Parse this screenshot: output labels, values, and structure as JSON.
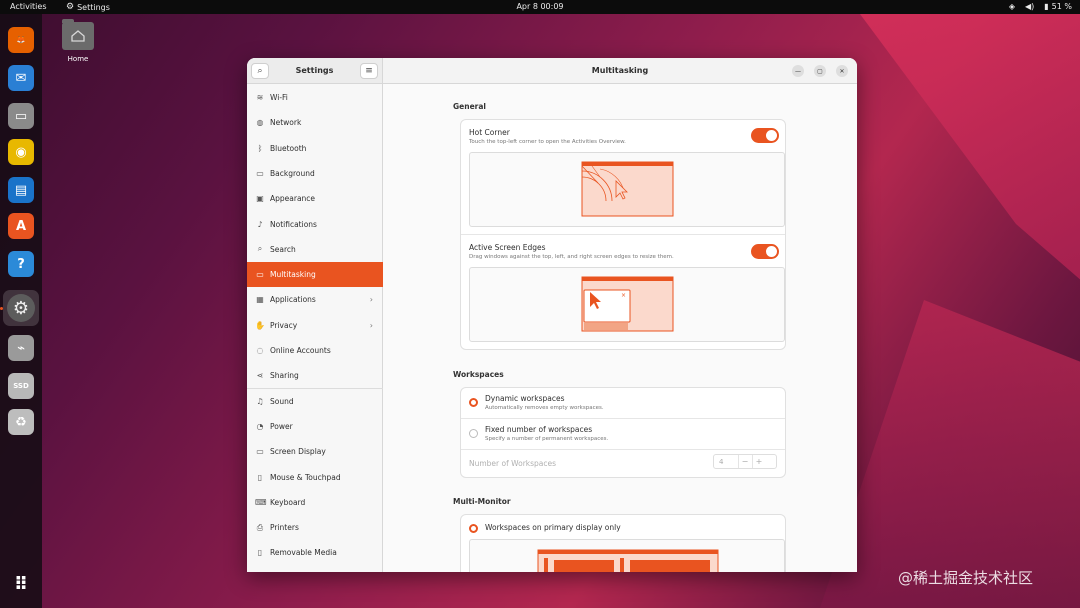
{
  "topbar": {
    "activities": "Activities",
    "app_name": "Settings",
    "clock": "Apr 8  00:09",
    "battery": "51 %"
  },
  "desktop": {
    "home_label": "Home"
  },
  "dock": {
    "items": [
      {
        "name": "firefox-icon",
        "glyph": "🦊",
        "color": "#e66000"
      },
      {
        "name": "thunderbird-icon",
        "glyph": "✉",
        "color": "#2a7fd4"
      },
      {
        "name": "files-icon",
        "glyph": "▭",
        "color": "#8a8a8a"
      },
      {
        "name": "rhythmbox-icon",
        "glyph": "◉",
        "color": "#e8b800"
      },
      {
        "name": "writer-icon",
        "glyph": "▤",
        "color": "#1a73c9"
      },
      {
        "name": "software-icon",
        "glyph": "A",
        "color": "#e95420"
      },
      {
        "name": "help-icon",
        "glyph": "?",
        "color": "#2b8ad8"
      },
      {
        "name": "settings-icon",
        "glyph": "⚙",
        "color": "#7a7a7a"
      },
      {
        "name": "usb-drive-icon",
        "glyph": "⌁",
        "color": "#9a9a9a"
      },
      {
        "name": "ssd-drive-icon",
        "glyph": "SSD",
        "color": "#b8b8b8"
      },
      {
        "name": "trash-icon",
        "glyph": "♻",
        "color": "#bdbdbd"
      },
      {
        "name": "app-grid-icon",
        "glyph": "⠿",
        "color": "transparent"
      }
    ]
  },
  "settings": {
    "sidebar_title": "Settings",
    "window_title": "Multitasking",
    "sidebar_items": [
      {
        "label": "Wi-Fi",
        "icon": "wifi-icon",
        "glyph": "≋"
      },
      {
        "label": "Network",
        "icon": "network-icon",
        "glyph": "◍"
      },
      {
        "label": "Bluetooth",
        "icon": "bluetooth-icon",
        "glyph": "ᛒ"
      },
      {
        "label": "Background",
        "icon": "background-icon",
        "glyph": "▭"
      },
      {
        "label": "Appearance",
        "icon": "appearance-icon",
        "glyph": "▣"
      },
      {
        "label": "Notifications",
        "icon": "bell-icon",
        "glyph": "♪"
      },
      {
        "label": "Search",
        "icon": "search-icon",
        "glyph": "⌕"
      },
      {
        "label": "Multitasking",
        "icon": "multitasking-icon",
        "glyph": "▭"
      },
      {
        "label": "Applications",
        "icon": "applications-icon",
        "glyph": "▦"
      },
      {
        "label": "Privacy",
        "icon": "privacy-icon",
        "glyph": "✋"
      },
      {
        "label": "Online Accounts",
        "icon": "online-accounts-icon",
        "glyph": "◌"
      },
      {
        "label": "Sharing",
        "icon": "share-icon",
        "glyph": "⋖"
      },
      {
        "label": "Sound",
        "icon": "music-note-icon",
        "glyph": "♫"
      },
      {
        "label": "Power",
        "icon": "power-icon",
        "glyph": "◔"
      },
      {
        "label": "Screen Display",
        "icon": "display-icon",
        "glyph": "▭"
      },
      {
        "label": "Mouse & Touchpad",
        "icon": "mouse-icon",
        "glyph": "▯"
      },
      {
        "label": "Keyboard",
        "icon": "keyboard-icon",
        "glyph": "⌨"
      },
      {
        "label": "Printers",
        "icon": "printer-icon",
        "glyph": "⎙"
      },
      {
        "label": "Removable Media",
        "icon": "removable-media-icon",
        "glyph": "▯"
      }
    ],
    "active_item": "Multitasking",
    "general": {
      "heading": "General",
      "hot_corner": {
        "title": "Hot Corner",
        "subtitle": "Touch the top-left corner to open the Activities Overview.",
        "enabled": true
      },
      "screen_edges": {
        "title": "Active Screen Edges",
        "subtitle": "Drag windows against the top, left, and right screen edges to resize them.",
        "enabled": true
      }
    },
    "workspaces": {
      "heading": "Workspaces",
      "dynamic": {
        "title": "Dynamic workspaces",
        "subtitle": "Automatically removes empty workspaces.",
        "selected": true
      },
      "fixed": {
        "title": "Fixed number of workspaces",
        "subtitle": "Specify a number of permanent workspaces.",
        "selected": false
      },
      "count_label": "Number of Workspaces",
      "count_value": "4",
      "minus": "−",
      "plus": "+"
    },
    "multi_monitor": {
      "heading": "Multi-Monitor",
      "primary_only": {
        "title": "Workspaces on primary display only",
        "selected": true
      }
    }
  },
  "colors": {
    "accent": "#e95420",
    "illustration_fill": "#fbd9cc"
  },
  "watermark": "@稀土掘金技术社区"
}
